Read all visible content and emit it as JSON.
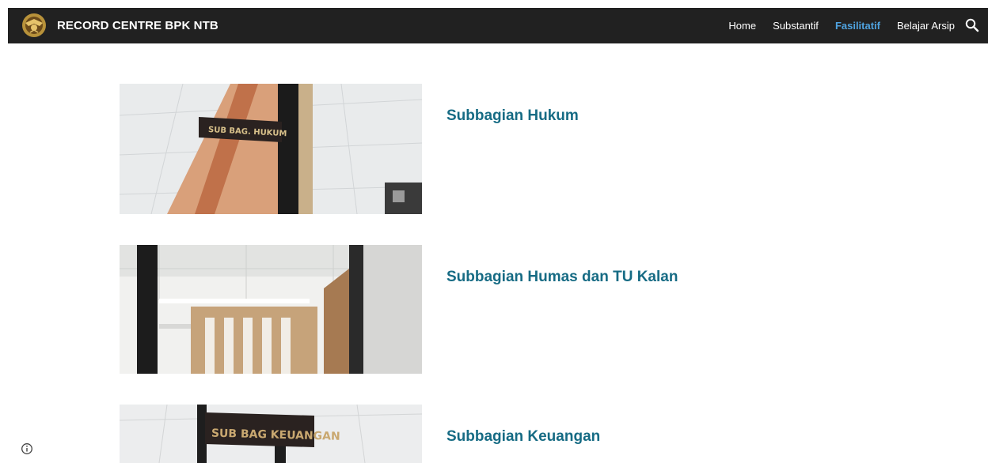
{
  "header": {
    "site_title": "RECORD CENTRE BPK NTB",
    "logo_icon": "bpk-emblem-icon",
    "background": "#212121"
  },
  "nav": {
    "items": [
      {
        "label": "Home",
        "active": false
      },
      {
        "label": "Substantif",
        "active": false
      },
      {
        "label": "Fasilitatif",
        "active": true
      },
      {
        "label": "Belajar Arsip",
        "active": false
      }
    ],
    "active_color": "#4fa3e0",
    "search_icon": "search-icon"
  },
  "cards": [
    {
      "title": "Subbagian Hukum",
      "sign_text": "SUB BAG. HUKUM"
    },
    {
      "title": "Subbagian Humas dan TU Kalan",
      "sign_text": ""
    },
    {
      "title": "Subbagian Keuangan",
      "sign_text": "SUB BAG KEUANGAN"
    }
  ],
  "title_color": "#166b84",
  "footer": {
    "info_icon": "info-icon"
  }
}
